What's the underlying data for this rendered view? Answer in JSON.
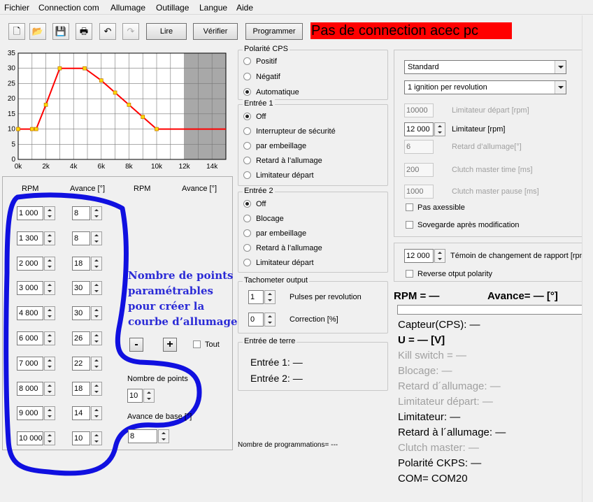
{
  "menu": [
    "Fichier",
    "Connection com",
    "Allumage",
    "Outillage",
    "Langue",
    "Aide"
  ],
  "toolbar": {
    "icons": [
      "new-file-icon",
      "open-folder-icon",
      "save-icon",
      "print-icon",
      "undo-icon",
      "redo-icon"
    ],
    "lire": "Lire",
    "verifier": "Vérifier",
    "programmer": "Programmer"
  },
  "status_banner": "Pas de connection acec pc",
  "colors": {
    "banner": "#ff0000",
    "curve": "#ff0000",
    "point": "#ffd700",
    "annotation": "#2b2bd6"
  },
  "chart_data": {
    "type": "line",
    "x": [
      0,
      1000,
      1300,
      2000,
      3000,
      4800,
      6000,
      7000,
      8000,
      9000,
      10000,
      15000
    ],
    "y": [
      10,
      10,
      10,
      18,
      30,
      30,
      26,
      22,
      18,
      14,
      10,
      10
    ],
    "markers_x": [
      0,
      1000,
      1300,
      2000,
      3000,
      4800,
      6000,
      7000,
      8000,
      9000,
      10000
    ],
    "xlim": [
      0,
      15000
    ],
    "ylim": [
      0,
      35
    ],
    "xticks": [
      "0k",
      "2k",
      "4k",
      "6k",
      "8k",
      "10k",
      "12k",
      "14k"
    ],
    "yticks": [
      "35",
      "30",
      "25",
      "20",
      "15",
      "10",
      "5",
      "0"
    ],
    "limit_region_start": 12000,
    "grid": true
  },
  "table": {
    "headers": [
      "RPM",
      "Avance [°]",
      "RPM",
      "Avance [°]"
    ],
    "rows": [
      {
        "rpm": "1 000",
        "avance": "8"
      },
      {
        "rpm": "1 300",
        "avance": "8"
      },
      {
        "rpm": "2 000",
        "avance": "18"
      },
      {
        "rpm": "3 000",
        "avance": "30"
      },
      {
        "rpm": "4 800",
        "avance": "30"
      },
      {
        "rpm": "6 000",
        "avance": "26"
      },
      {
        "rpm": "7 000",
        "avance": "22"
      },
      {
        "rpm": "8 000",
        "avance": "18"
      },
      {
        "rpm": "9 000",
        "avance": "14"
      },
      {
        "rpm": "10 000",
        "avance": "10"
      }
    ]
  },
  "annotation": "Nombre de points paramétrables pour créer la courbe d’allumage",
  "points": {
    "minus": "-",
    "plus": "+",
    "tout": "Tout",
    "nombre_label": "Nombre de points",
    "nombre_value": "10",
    "avance_base_label": "Avance de base [°]",
    "avance_base_value": "8"
  },
  "polarite": {
    "title": "Polarité CPS",
    "options": [
      "Positif",
      "Négatif",
      "Automatique"
    ],
    "selected": 2
  },
  "entree1": {
    "title": "Entrée 1",
    "options": [
      "Off",
      "Interrupteur de sécurité",
      "par embeillage",
      "Retard à l’allumage",
      "Limitateur départ"
    ],
    "selected": 0
  },
  "entree2": {
    "title": "Entrée 2",
    "options": [
      "Off",
      "Blocage",
      "par embeillage",
      "Retard à l’allumage",
      "Limitateur départ"
    ],
    "selected": 0
  },
  "tachometer": {
    "title": "Tachometer output",
    "pulses_value": "1",
    "pulses_label": "Pulses per revolution",
    "correction_value": "0",
    "correction_label": "Correction [%]"
  },
  "terre": {
    "title": "Entrée de terre",
    "e1": "Entrée 1: —",
    "e2": "Entrée 2: —"
  },
  "nb_programmations": "Nombre de programmations= ---",
  "settings": {
    "mode": "Standard",
    "ignition": "1 ignition per revolution",
    "limit_depart_value": "10000",
    "limit_depart_label": "Limitateur départ [rpm]",
    "limitateur_value": "12 000",
    "limitateur_label": "Limitateur [rpm]",
    "retard_value": "6",
    "retard_label": "Retard d’allumage[°]",
    "clutch_time_value": "200",
    "clutch_time_label": "Clutch master time [ms]",
    "clutch_pause_value": "1000",
    "clutch_pause_label": "Clutch master pause [ms]",
    "pas_axessible": "Pas axessible",
    "sovegarde": "Sovegarde après modification"
  },
  "shift": {
    "value": "12 000",
    "label": "Témoin de changement de rapport [rpm]",
    "reverse": "Reverse otput polarity"
  },
  "live": {
    "rpm": "RPM = —",
    "avance": "Avance= — [°]",
    "capteur": "Capteur(CPS): —",
    "voltage": "U = — [V]",
    "kill": "Kill switch = —",
    "blocage": "Blocage: —",
    "retard": "Retard d´allumage: —",
    "limit_depart": "Limitateur départ: —",
    "limitateur": "Limitateur: —",
    "retard2": "Retard à l´allumage: —",
    "clutch": "Clutch master: —",
    "polarite": "Polarité CKPS: —",
    "com": "COM= COM20"
  }
}
